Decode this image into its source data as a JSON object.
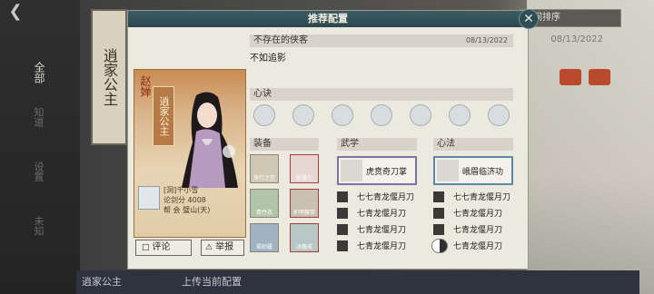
{
  "background": {
    "banner_text": "逍家公主",
    "side_tab": "全部",
    "side_items": [
      "知道",
      "设置",
      "未知"
    ],
    "sort_label": "时间排序",
    "date": "08/13/2022",
    "bottom_name": "逍家公主",
    "bottom_upload": "上传当前配置"
  },
  "modal": {
    "title": "推荐配置",
    "hero_label": "不存在的侠客",
    "hero_date": "08/13/2022",
    "subtitle": "不如追影",
    "mind_label": "心诀",
    "equip_label": "装备",
    "wuxue_label": "武学",
    "xinfa_label": "心法",
    "card": {
      "name": "赵婵",
      "title": "逍家公主",
      "info_lines": [
        "[洞]千小雪",
        "论剑分 4008",
        "帮  会 璧山(天)"
      ]
    },
    "review_label": "评论",
    "report_label": "举报",
    "equipment": [
      {
        "label": "旅行之笠"
      },
      {
        "label": "影锋刃"
      },
      {
        "label": "青竹衣"
      },
      {
        "label": "护甲腰带"
      },
      {
        "label": "翠织履"
      },
      {
        "label": "冰魄戒"
      }
    ],
    "wuxue_card": "虎贲奇刀掌",
    "xinfa_card": "峨眉临济功",
    "wuxue_list": [
      "七七青龙偃月刀",
      "七青龙偃月刀",
      "七青龙偃月刀",
      "七青龙偃月刀"
    ],
    "xinfa_list": [
      "七七青龙偃月刀",
      "七青龙偃月刀",
      "七青龙偃月刀",
      "七青龙偃月刀"
    ]
  },
  "colors": {
    "header": "#2c474d",
    "card_gold": "#c88c52",
    "wuxue_border": "#7a73a8",
    "xinfa_border": "#5a87a6"
  }
}
